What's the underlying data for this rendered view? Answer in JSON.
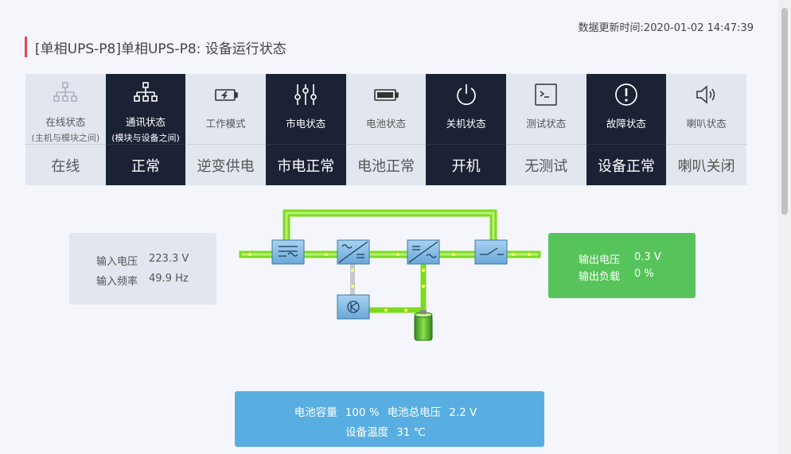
{
  "header": {
    "updated_label": "数据更新时间:",
    "updated_time": "2020-01-02 14:47:39",
    "title": "[单相UPS-P8]单相UPS-P8: 设备运行状态"
  },
  "status_cards": [
    {
      "label": "在线状态",
      "sub": "(主机与模块之间)",
      "value": "在线",
      "icon": "network-tree-icon",
      "theme": "light"
    },
    {
      "label": "通讯状态",
      "sub": "(模块与设备之间)",
      "value": "正常",
      "icon": "network-tree-icon",
      "theme": "dark"
    },
    {
      "label": "工作模式",
      "sub": "",
      "value": "逆变供电",
      "icon": "battery-charge-icon",
      "theme": "light"
    },
    {
      "label": "市电状态",
      "sub": "",
      "value": "市电正常",
      "icon": "sliders-icon",
      "theme": "dark"
    },
    {
      "label": "电池状态",
      "sub": "",
      "value": "电池正常",
      "icon": "battery-icon",
      "theme": "light"
    },
    {
      "label": "关机状态",
      "sub": "",
      "value": "开机",
      "icon": "power-icon",
      "theme": "dark"
    },
    {
      "label": "测试状态",
      "sub": "",
      "value": "无测试",
      "icon": "terminal-icon",
      "theme": "light"
    },
    {
      "label": "故障状态",
      "sub": "",
      "value": "设备正常",
      "icon": "alert-circle-icon",
      "theme": "dark"
    },
    {
      "label": "喇叭状态",
      "sub": "",
      "value": "喇叭关闭",
      "icon": "speaker-icon",
      "theme": "light"
    }
  ],
  "input": {
    "voltage_label": "输入电压",
    "voltage_value": "223.3 V",
    "frequency_label": "输入频率",
    "frequency_value": "49.9 Hz"
  },
  "output": {
    "voltage_label": "输出电压",
    "voltage_value": "0.3 V",
    "load_label": "输出负载",
    "load_value": "0 %"
  },
  "battery": {
    "capacity_label": "电池容量",
    "capacity_value": "100 %",
    "total_voltage_label": "电池总电压",
    "total_voltage_value": "2.2 V",
    "temp_label": "设备温度",
    "temp_value": "31 ℃"
  },
  "colors": {
    "dark_card": "#1b2235",
    "light_card": "#e2e6ee",
    "output_green": "#56c45a",
    "battery_blue": "#58aee0",
    "title_accent": "#e2474f",
    "flow_green": "#7ddc1f"
  }
}
